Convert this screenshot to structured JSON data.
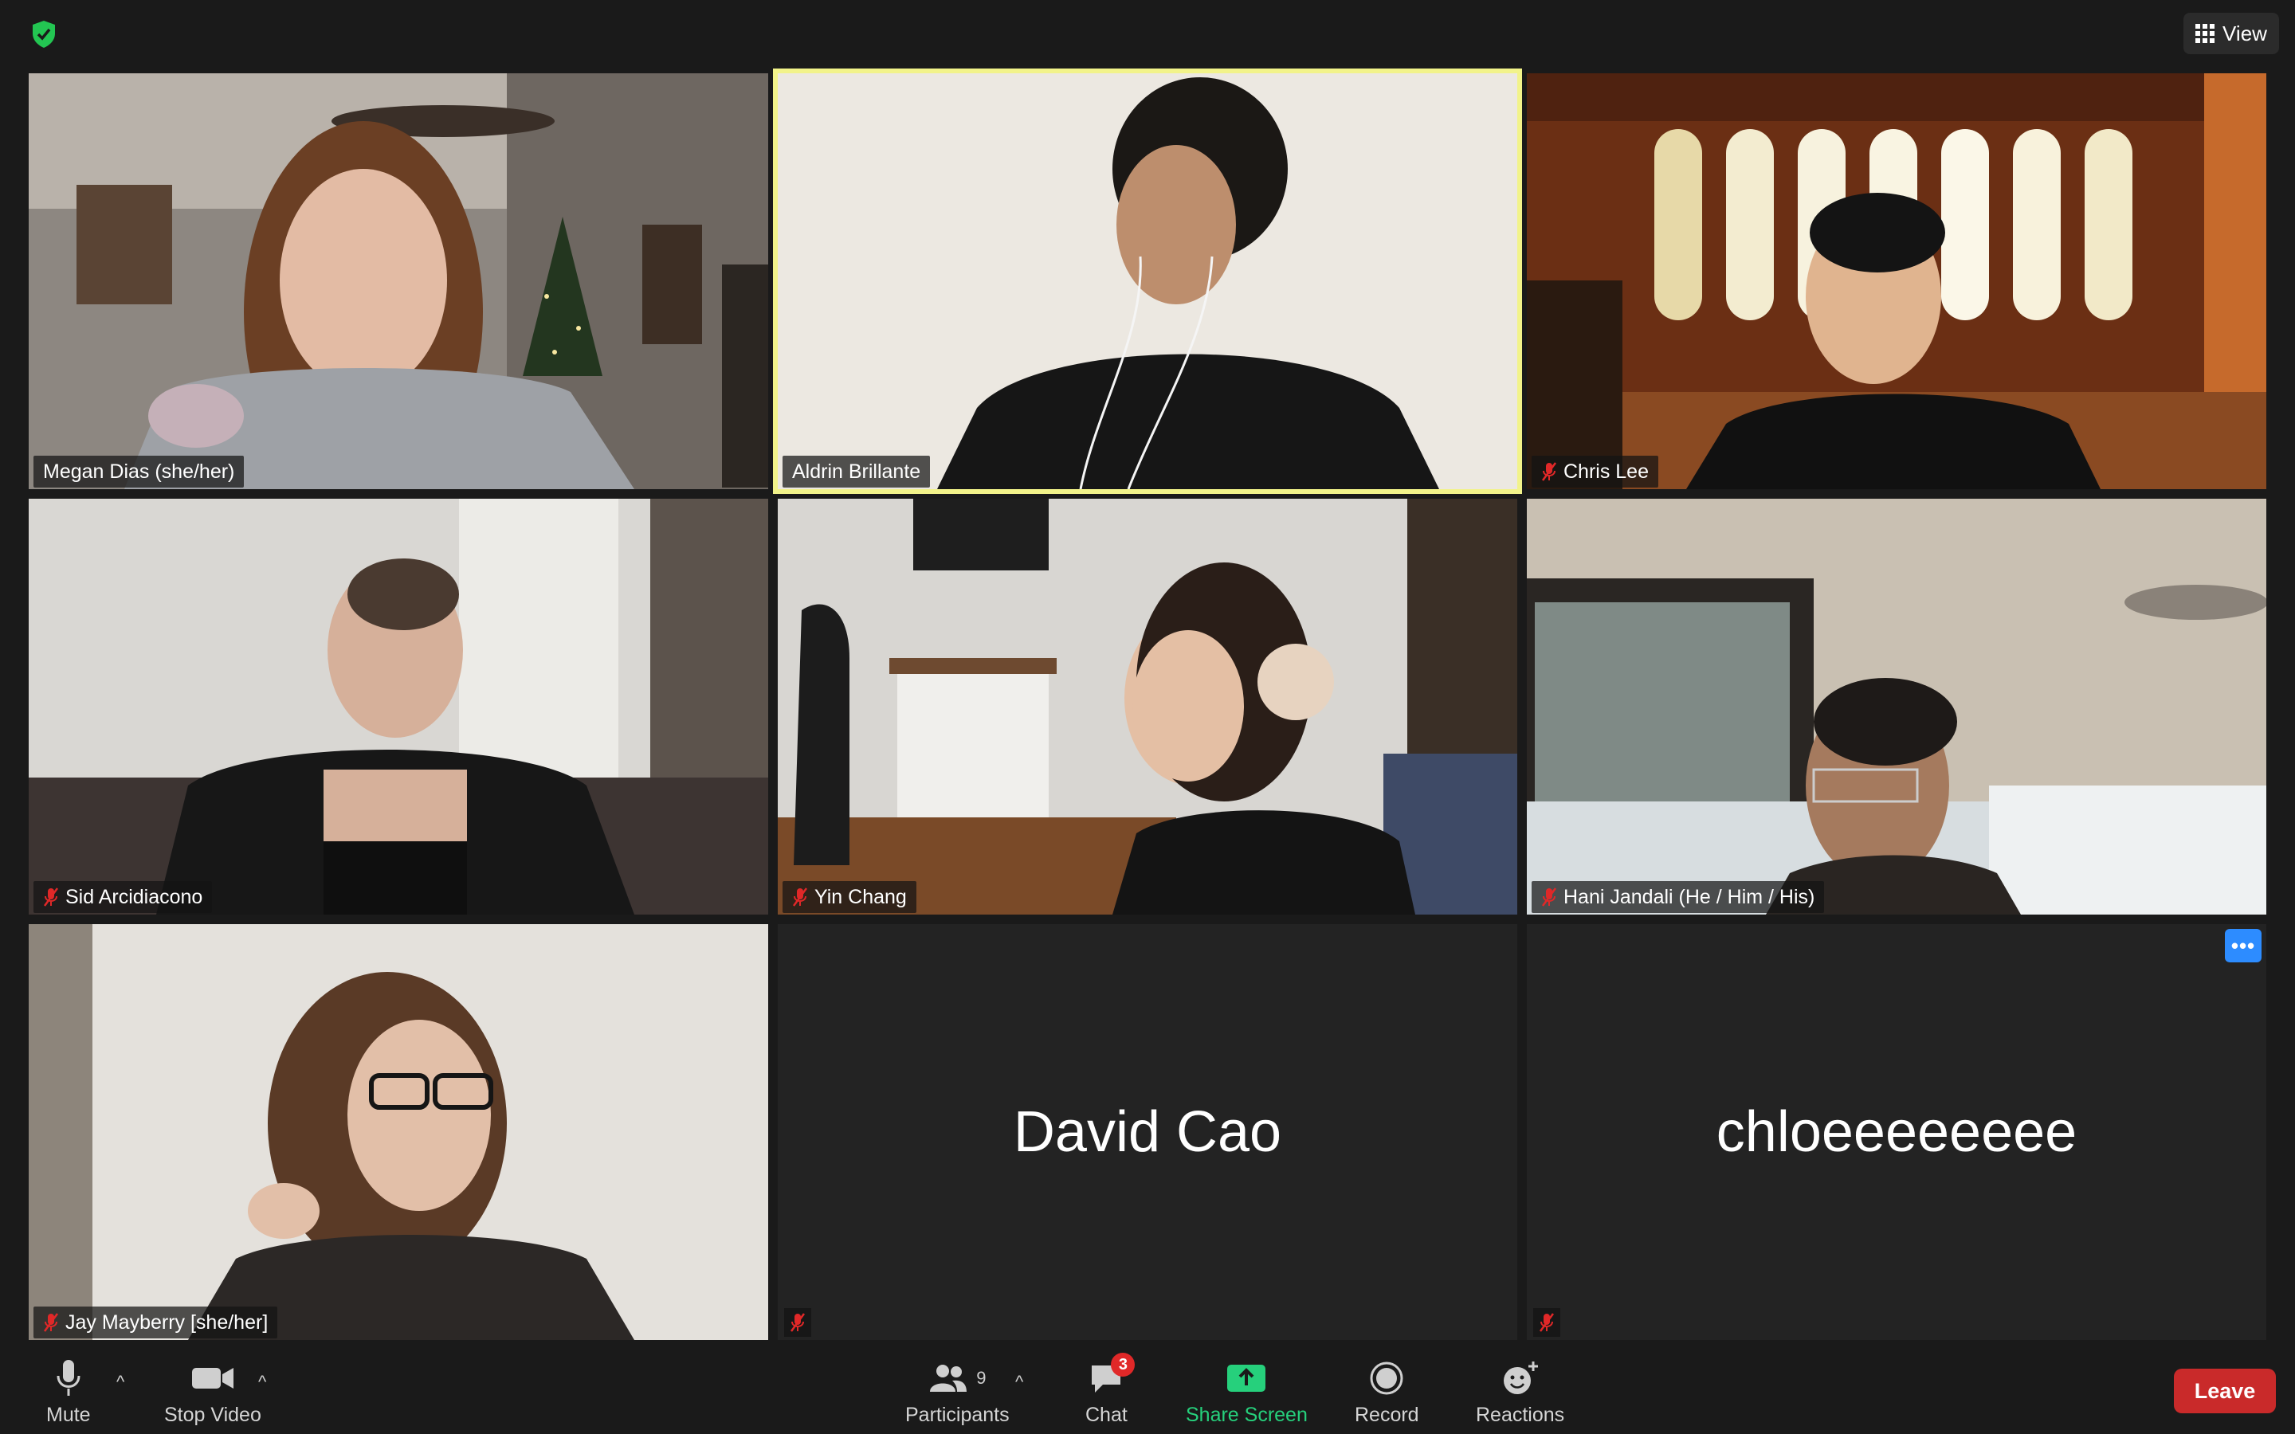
{
  "header": {
    "view_label": "View"
  },
  "participants": [
    {
      "name": "Megan Dias (she/her)",
      "muted": false
    },
    {
      "name": "Aldrin Brillante",
      "muted": false,
      "active_speaker": true
    },
    {
      "name": "Chris Lee",
      "muted": true
    },
    {
      "name": "Sid Arcidiacono",
      "muted": true
    },
    {
      "name": "Yin Chang",
      "muted": true
    },
    {
      "name": "Hani Jandali (He / Him / His)",
      "muted": true
    },
    {
      "name": "Jay Mayberry [she/her]",
      "muted": true
    },
    {
      "name": "David Cao",
      "muted": true,
      "video": false
    },
    {
      "name": "chloeeeeeeee",
      "muted": true,
      "video": false
    }
  ],
  "toolbar": {
    "mute_label": "Mute",
    "stop_video_label": "Stop Video",
    "participants_label": "Participants",
    "participants_count": "9",
    "chat_label": "Chat",
    "chat_badge": "3",
    "share_label": "Share Screen",
    "record_label": "Record",
    "reactions_label": "Reactions",
    "leave_label": "Leave"
  },
  "colors": {
    "active_speaker_border": "#f2f38a",
    "share_green": "#26d07c",
    "leave_red": "#c92a2a",
    "more_blue": "#2d8cff",
    "muted_red": "#e02828"
  },
  "icons": {
    "security": "shield-check-icon",
    "view": "grid-icon",
    "mute": "microphone-icon",
    "video": "video-camera-icon",
    "participants": "people-icon",
    "chat": "chat-bubble-icon",
    "share": "share-screen-icon",
    "record": "record-icon",
    "reactions": "emoji-plus-icon",
    "muted": "mic-muted-icon",
    "more": "more-options-icon"
  }
}
